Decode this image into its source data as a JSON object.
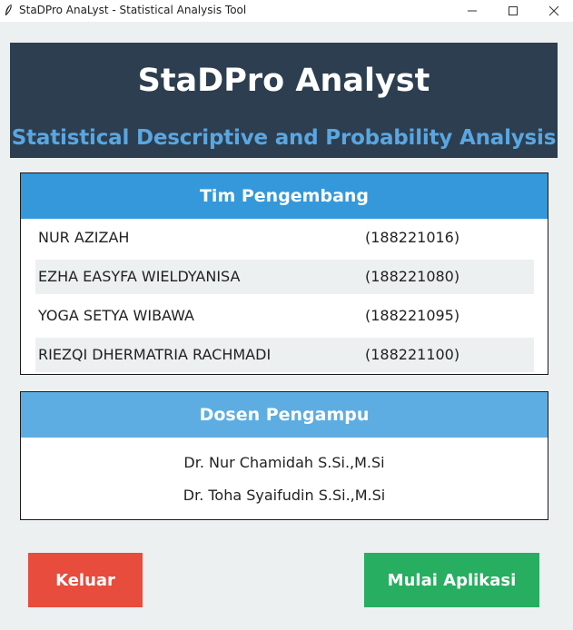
{
  "window": {
    "title": "StaDPro AnaLyst - Statistical Analysis Tool",
    "icons": [
      "feather-icon",
      "minimize-icon",
      "maximize-icon",
      "close-icon"
    ]
  },
  "header": {
    "title": "StaDPro Analyst",
    "subtitle": "Statistical Descriptive and Probability Analysis",
    "background": "#2c3e50",
    "subtitle_color": "#5aa6e0"
  },
  "team": {
    "heading": "Tim Pengembang",
    "accent": "#3498db",
    "members": [
      {
        "name": "NUR AZIZAH",
        "id": "(188221016)"
      },
      {
        "name": "EZHA EASYFA WIELDYANISA",
        "id": "(188221080)"
      },
      {
        "name": "YOGA SETYA WIBAWA",
        "id": "(188221095)"
      },
      {
        "name": "RIEZQI DHERMATRIA RACHMADI",
        "id": "(188221100)"
      }
    ]
  },
  "dosen": {
    "heading": "Dosen Pengampu",
    "accent": "#5dade2",
    "names": [
      "Dr. Nur Chamidah S.Si.,M.Si",
      "Dr. Toha Syaifudin S.Si.,M.Si"
    ]
  },
  "buttons": {
    "exit_label": "Keluar",
    "exit_color": "#e74c3c",
    "start_label": "Mulai Aplikasi",
    "start_color": "#27ae60"
  }
}
